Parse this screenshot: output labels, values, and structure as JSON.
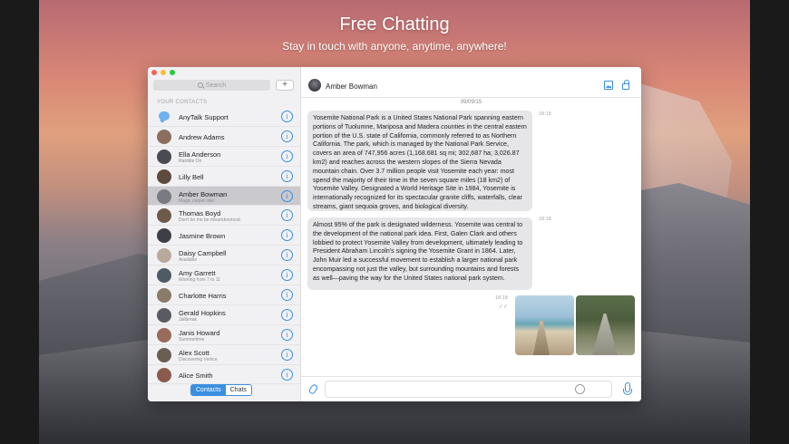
{
  "hero": {
    "title": "Free Chatting",
    "subtitle": "Stay in touch with anyone, anytime, anywhere!"
  },
  "sidebar": {
    "search_placeholder": "Search",
    "add_label": "+",
    "section_label": "YOUR CONTACTS",
    "contacts": [
      {
        "name": "AnyTalk Support",
        "status": "",
        "avatar_color": "#6cb2f0"
      },
      {
        "name": "Andrew Adams",
        "status": "",
        "avatar_color": "#8a6f5e"
      },
      {
        "name": "Ella Anderson",
        "status": "Ramble On",
        "avatar_color": "#4a4a52"
      },
      {
        "name": "Lilly Bell",
        "status": "",
        "avatar_color": "#5e4a3e"
      },
      {
        "name": "Amber Bowman",
        "status": "Magic carpet ride!",
        "avatar_color": "#7a7a82"
      },
      {
        "name": "Thomas Boyd",
        "status": "Don't let me be misunderstood",
        "avatar_color": "#6e5a4a"
      },
      {
        "name": "Jasmine Brown",
        "status": "",
        "avatar_color": "#3e3e46"
      },
      {
        "name": "Daisy Campbell",
        "status": "Available",
        "avatar_color": "#b9a99a"
      },
      {
        "name": "Amy Garrett",
        "status": "Working from 7 to 11",
        "avatar_color": "#4e5a66"
      },
      {
        "name": "Charlotte Harris",
        "status": "",
        "avatar_color": "#8a7a6a"
      },
      {
        "name": "Gerald Hopkins",
        "status": "Jailbreak",
        "avatar_color": "#5a5a62"
      },
      {
        "name": "Janis Howard",
        "status": "Summertime",
        "avatar_color": "#9a6a5a"
      },
      {
        "name": "Alex Scott",
        "status": "Discovering Venice",
        "avatar_color": "#6a5e52"
      },
      {
        "name": "Alice Smith",
        "status": "",
        "avatar_color": "#8a5a4e"
      }
    ],
    "info_glyph": "i",
    "tabs": {
      "contacts": "Contacts",
      "chats": "Chats"
    }
  },
  "chat": {
    "contact_name": "Amber Bowman",
    "date": "09/09/15",
    "messages": [
      {
        "time": "18:18",
        "text": "Yosemite National Park is a United States National Park spanning eastern portions of Tuolumne, Mariposa and Madera counties in the central eastern portion of the U.S. state of California, commonly referred to as Northern California. The park, which is managed by the National Park Service, covers an area of 747,956 acres (1,168.681 sq mi; 302,687 ha; 3,026.87 km2) and reaches across the western slopes of the Sierra Nevada mountain chain. Over 3.7 million people visit Yosemite each year: most spend the majority of their time in the seven square miles (18 km2) of Yosemite Valley. Designated a World Heritage Site in 1984, Yosemite is internationally recognized for its spectacular granite cliffs, waterfalls, clear streams, giant sequoia groves, and biological diversity."
      },
      {
        "time": "18:18",
        "text": "Almost 95% of the park is designated wilderness. Yosemite was central to the development of the national park idea. First, Galen Clark and others lobbied to protect Yosemite Valley from development, ultimately leading to President Abraham Lincoln's signing the Yosemite Grant in 1864. Later, John Muir led a successful movement to establish a larger national park encompassing not just the valley, but surrounding mountains and forests as well—paving the way for the United States national park system."
      }
    ],
    "photos_time": "18:18",
    "read_ticks": "✓✓"
  }
}
